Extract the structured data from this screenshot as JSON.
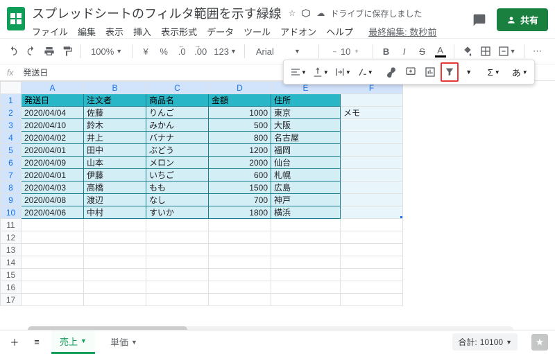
{
  "doc": {
    "title": "スプレッドシートのフィルタ範囲を示す緑線",
    "drive_status": "ドライブに保存しました",
    "last_edit": "最終編集: 数秒前",
    "share_label": "共有"
  },
  "menu": [
    "ファイル",
    "編集",
    "表示",
    "挿入",
    "表示形式",
    "データ",
    "ツール",
    "アドオン",
    "ヘルプ"
  ],
  "toolbar": {
    "zoom": "100%",
    "currency": "¥",
    "percent": "%",
    "dec_dec": ".0",
    "inc_dec": ".00",
    "numfmt": "123",
    "font": "Arial",
    "size": "10",
    "bold": "B",
    "italic": "I",
    "strike": "S",
    "underline_a": "A",
    "input_lang": "あ"
  },
  "fx": {
    "label": "fx",
    "value": "発送日"
  },
  "columns": [
    "A",
    "B",
    "C",
    "D",
    "E",
    "F"
  ],
  "headers": [
    "発送日",
    "注文者",
    "商品名",
    "金額",
    "住所"
  ],
  "memo_label": "メモ",
  "rows": [
    {
      "date": "2020/04/04",
      "name": "佐藤",
      "item": "りんご",
      "amount": "1000",
      "addr": "東京"
    },
    {
      "date": "2020/04/10",
      "name": "鈴木",
      "item": "みかん",
      "amount": "500",
      "addr": "大阪"
    },
    {
      "date": "2020/04/02",
      "name": "井上",
      "item": "バナナ",
      "amount": "800",
      "addr": "名古屋"
    },
    {
      "date": "2020/04/01",
      "name": "田中",
      "item": "ぶどう",
      "amount": "1200",
      "addr": "福岡"
    },
    {
      "date": "2020/04/09",
      "name": "山本",
      "item": "メロン",
      "amount": "2000",
      "addr": "仙台"
    },
    {
      "date": "2020/04/01",
      "name": "伊藤",
      "item": "いちご",
      "amount": "600",
      "addr": "札幌"
    },
    {
      "date": "2020/04/03",
      "name": "高橋",
      "item": "もも",
      "amount": "1500",
      "addr": "広島"
    },
    {
      "date": "2020/04/08",
      "name": "渡辺",
      "item": "なし",
      "amount": "700",
      "addr": "神戸"
    },
    {
      "date": "2020/04/06",
      "name": "中村",
      "item": "すいか",
      "amount": "1800",
      "addr": "横浜"
    }
  ],
  "empty_rows": [
    11,
    12,
    13,
    14,
    15,
    16,
    17
  ],
  "tabs": {
    "active": "売上",
    "other": "単価"
  },
  "summary": {
    "label": "合計:",
    "value": "10100"
  }
}
